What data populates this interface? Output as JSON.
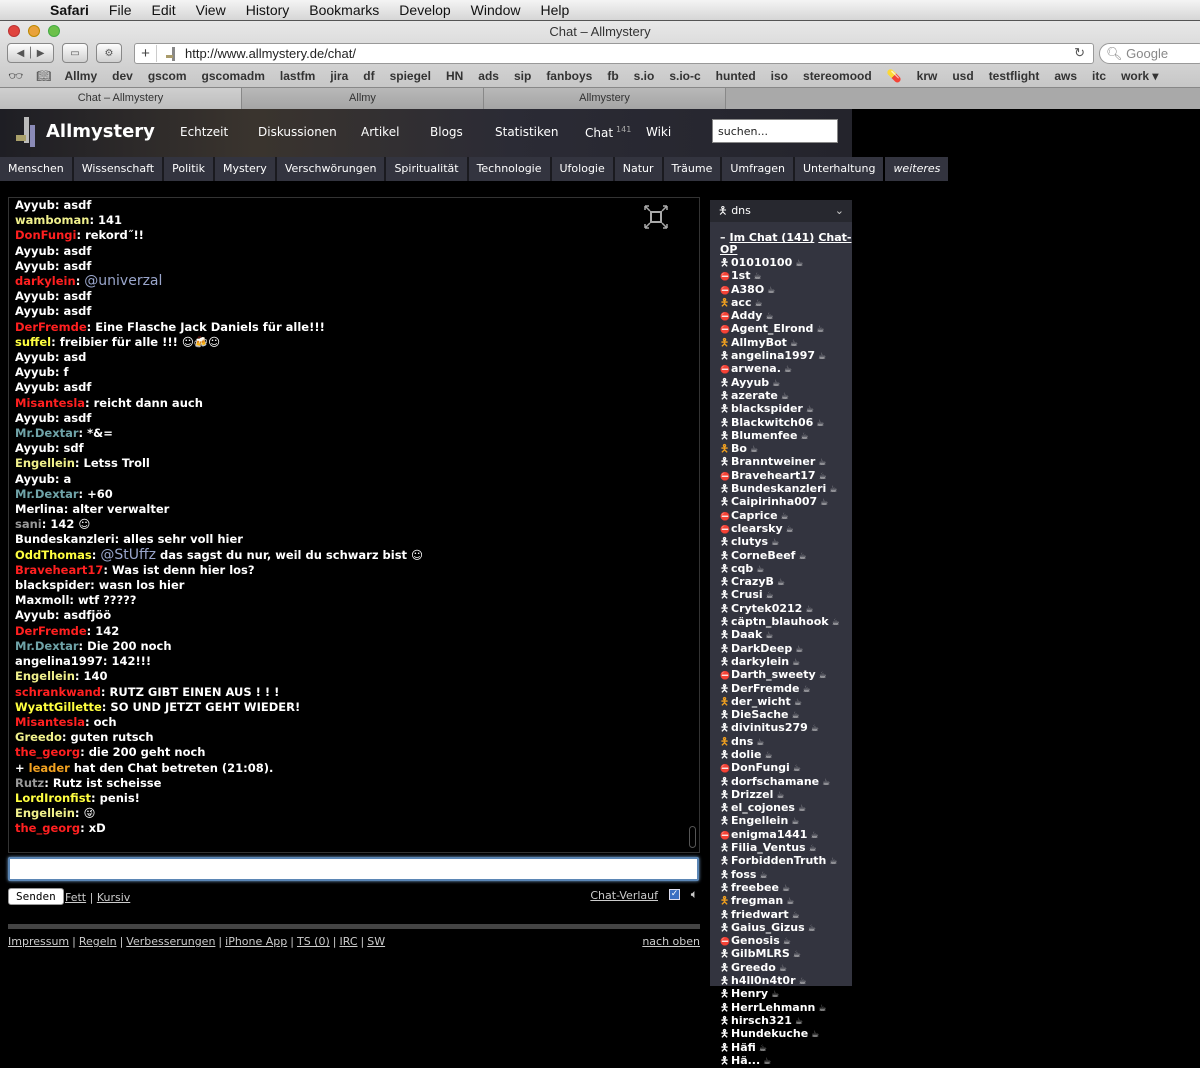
{
  "menubar": {
    "apple": "",
    "items": [
      "Safari",
      "File",
      "Edit",
      "View",
      "History",
      "Bookmarks",
      "Develop",
      "Window",
      "Help"
    ]
  },
  "window": {
    "title": "Chat – Allmystery",
    "url": "http://www.allmystery.de/chat/",
    "search_placeholder": "Google"
  },
  "bookmarks": [
    "Allmy",
    "dev",
    "gscom",
    "gscomadm",
    "lastfm",
    "jira",
    "df",
    "spiegel",
    "HN",
    "ads",
    "sip",
    "fanboys",
    "fb",
    "s.io",
    "s.io-c",
    "hunted",
    "iso",
    "stereomood",
    "krw",
    "usd",
    "testflight",
    "aws",
    "itc",
    "work ▾"
  ],
  "tabs": [
    {
      "label": "Chat – Allmystery",
      "active": true
    },
    {
      "label": "Allmy",
      "active": false
    },
    {
      "label": "Allmystery",
      "active": false
    }
  ],
  "site": {
    "brand": "Allmystery",
    "nav": [
      "Echtzeit",
      "Diskussionen",
      "Artikel",
      "Blogs",
      "Statistiken",
      "Chat",
      "Wiki"
    ],
    "chat_count": "141",
    "search_placeholder": "suchen...",
    "categories": [
      "Menschen",
      "Wissenschaft",
      "Politik",
      "Mystery",
      "Verschwörungen",
      "Spiritualität",
      "Technologie",
      "Ufologie",
      "Natur",
      "Träume",
      "Umfragen",
      "Unterhaltung",
      "weiteres"
    ]
  },
  "colors": {
    "red": "#ff2020",
    "yellow": "#ffff40",
    "lightyellow": "#f0f08c",
    "teal": "#6fa3a8",
    "white": "#ffffff",
    "grey": "#999999",
    "orange": "#f0a020"
  },
  "messages": [
    {
      "user": "Ayyub",
      "color": "white",
      "text": "asdf"
    },
    {
      "user": "wamboman",
      "color": "lightyellow",
      "text": "141"
    },
    {
      "user": "DonFungi",
      "color": "red",
      "text": "rekord˝!!"
    },
    {
      "user": "Ayyub",
      "color": "white",
      "text": "asdf"
    },
    {
      "user": "Ayyub",
      "color": "white",
      "text": "asdf"
    },
    {
      "user": "darkylein",
      "color": "red",
      "text": "",
      "big": "@univerzal"
    },
    {
      "user": "Ayyub",
      "color": "white",
      "text": "asdf"
    },
    {
      "user": "Ayyub",
      "color": "white",
      "text": "asdf"
    },
    {
      "user": "DerFremde",
      "color": "red",
      "text": "Eine Flasche Jack Daniels für alle!!!"
    },
    {
      "user": "suffel",
      "color": "yellow",
      "text": "freibier für alle !!! ☺🍻☺"
    },
    {
      "user": "Ayyub",
      "color": "white",
      "text": "asd"
    },
    {
      "user": "Ayyub",
      "color": "white",
      "text": "f"
    },
    {
      "user": "Ayyub",
      "color": "white",
      "text": "asdf"
    },
    {
      "user": "Misantesla",
      "color": "red",
      "text": "reicht dann auch"
    },
    {
      "user": "Ayyub",
      "color": "white",
      "text": "asdf"
    },
    {
      "user": "Mr.Dextar",
      "color": "teal",
      "text": "*&="
    },
    {
      "user": "Ayyub",
      "color": "white",
      "text": "sdf"
    },
    {
      "user": "Engellein",
      "color": "lightyellow",
      "text": "Letss Troll"
    },
    {
      "user": "Ayyub",
      "color": "white",
      "text": "a"
    },
    {
      "user": "Mr.Dextar",
      "color": "teal",
      "text": "+60"
    },
    {
      "user": "Merlina",
      "color": "white",
      "text": "alter verwalter"
    },
    {
      "user": "sani",
      "color": "grey",
      "text": "142 ☺"
    },
    {
      "user": "Bundeskanzleri",
      "color": "white",
      "text": "alles sehr voll hier"
    },
    {
      "user": "OddThomas",
      "color": "yellow",
      "big": "@StUffz",
      "text": "das sagst du nur, weil du schwarz bist ☺"
    },
    {
      "user": "Braveheart17",
      "color": "red",
      "text": "Was ist denn hier los?"
    },
    {
      "user": "blackspider",
      "color": "white",
      "text": "wasn los hier"
    },
    {
      "user": "Maxmoll",
      "color": "white",
      "text": "wtf ?????"
    },
    {
      "user": "Ayyub",
      "color": "white",
      "text": "asdfjöö"
    },
    {
      "user": "DerFremde",
      "color": "red",
      "text": "142"
    },
    {
      "user": "Mr.Dextar",
      "color": "teal",
      "text": "Die 200 noch"
    },
    {
      "user": "angelina1997",
      "color": "white",
      "text": "142!!!"
    },
    {
      "user": "Engellein",
      "color": "lightyellow",
      "text": "140"
    },
    {
      "user": "schrankwand",
      "color": "red",
      "text": "RUTZ GIBT EINEN AUS ! ! !"
    },
    {
      "user": "WyattGillette",
      "color": "yellow",
      "text": "SO UND JETZT GEHT WIEDER!"
    },
    {
      "user": "Misantesla",
      "color": "red",
      "text": "och"
    },
    {
      "user": "Greedo",
      "color": "lightyellow",
      "text": "guten rutsch"
    },
    {
      "user": "the_georg",
      "color": "red",
      "text": "die 200 geht noch"
    },
    {
      "system": true,
      "prefix": "+ ",
      "user": "leader",
      "color": "orange",
      "text": "hat den Chat betreten (21:08)."
    },
    {
      "user": "Rutz",
      "color": "grey",
      "text": "Rutz ist scheisse"
    },
    {
      "user": "LordIronfist",
      "color": "yellow",
      "text": "penis!"
    },
    {
      "user": "Engellein",
      "color": "lightyellow",
      "text": "😜"
    },
    {
      "user": "the_georg",
      "color": "red",
      "text": "xD"
    }
  ],
  "input": {
    "value": "",
    "send_label": "Senden",
    "bold_label": "Fett",
    "italic_label": "Kursiv",
    "history_label": "Chat-Verlauf",
    "sound_checked": true
  },
  "footer": {
    "links": [
      "Impressum",
      "Regeln",
      "Verbesserungen",
      "iPhone App",
      "TS (0)",
      "IRC",
      "SW"
    ],
    "top_label": "nach oben"
  },
  "userlist": {
    "current_user": "dns",
    "header_label": "Im Chat (141)",
    "op_label": "Chat-OP",
    "collapse": "–",
    "users": [
      {
        "name": "01010100",
        "s": "n"
      },
      {
        "name": "1st",
        "s": "r"
      },
      {
        "name": "A38O",
        "s": "r"
      },
      {
        "name": "acc",
        "s": "o"
      },
      {
        "name": "Addy",
        "s": "r"
      },
      {
        "name": "Agent_Elrond",
        "s": "r"
      },
      {
        "name": "AllmyBot",
        "s": "o"
      },
      {
        "name": "angelina1997",
        "s": "n"
      },
      {
        "name": "arwena.",
        "s": "r"
      },
      {
        "name": "Ayyub",
        "s": "n"
      },
      {
        "name": "azerate",
        "s": "n"
      },
      {
        "name": "blackspider",
        "s": "n"
      },
      {
        "name": "Blackwitch06",
        "s": "n"
      },
      {
        "name": "Blumenfee",
        "s": "n"
      },
      {
        "name": "Bo",
        "s": "o"
      },
      {
        "name": "Branntweiner",
        "s": "n"
      },
      {
        "name": "Braveheart17",
        "s": "r"
      },
      {
        "name": "Bundeskanzleri",
        "s": "n"
      },
      {
        "name": "Caipirinha007",
        "s": "n"
      },
      {
        "name": "Caprice",
        "s": "r"
      },
      {
        "name": "clearsky",
        "s": "r"
      },
      {
        "name": "clutys",
        "s": "n"
      },
      {
        "name": "CorneBeef",
        "s": "n"
      },
      {
        "name": "cqb",
        "s": "n"
      },
      {
        "name": "CrazyB",
        "s": "n"
      },
      {
        "name": "Crusi",
        "s": "n"
      },
      {
        "name": "Crytek0212",
        "s": "n"
      },
      {
        "name": "cäptn_blauhook",
        "s": "n"
      },
      {
        "name": "Daak",
        "s": "n"
      },
      {
        "name": "DarkDeep",
        "s": "n"
      },
      {
        "name": "darkylein",
        "s": "n"
      },
      {
        "name": "Darth_sweety",
        "s": "r"
      },
      {
        "name": "DerFremde",
        "s": "n"
      },
      {
        "name": "der_wicht",
        "s": "o"
      },
      {
        "name": "DieSache",
        "s": "n"
      },
      {
        "name": "divinitus279",
        "s": "n"
      },
      {
        "name": "dns",
        "s": "o"
      },
      {
        "name": "dolie",
        "s": "n"
      },
      {
        "name": "DonFungi",
        "s": "r"
      },
      {
        "name": "dorfschamane",
        "s": "n"
      },
      {
        "name": "Drizzel",
        "s": "n"
      },
      {
        "name": "el_cojones",
        "s": "n"
      },
      {
        "name": "Engellein",
        "s": "n"
      },
      {
        "name": "enigma1441",
        "s": "r"
      },
      {
        "name": "Filia_Ventus",
        "s": "n"
      },
      {
        "name": "ForbiddenTruth",
        "s": "n"
      },
      {
        "name": "foss",
        "s": "n"
      },
      {
        "name": "freebee",
        "s": "n"
      },
      {
        "name": "fregman",
        "s": "o"
      },
      {
        "name": "friedwart",
        "s": "n"
      },
      {
        "name": "Gaius_Gizus",
        "s": "n"
      },
      {
        "name": "Genosis",
        "s": "r"
      },
      {
        "name": "GilbMLRS",
        "s": "n"
      },
      {
        "name": "Greedo",
        "s": "n"
      },
      {
        "name": "h4ll0n4t0r",
        "s": "n"
      },
      {
        "name": "Henry",
        "s": "n"
      },
      {
        "name": "HerrLehmann",
        "s": "n"
      },
      {
        "name": "hirsch321",
        "s": "n"
      },
      {
        "name": "Hundekuche",
        "s": "n"
      },
      {
        "name": "Häfi",
        "s": "n"
      },
      {
        "name": "Hä...",
        "s": "n"
      }
    ]
  }
}
